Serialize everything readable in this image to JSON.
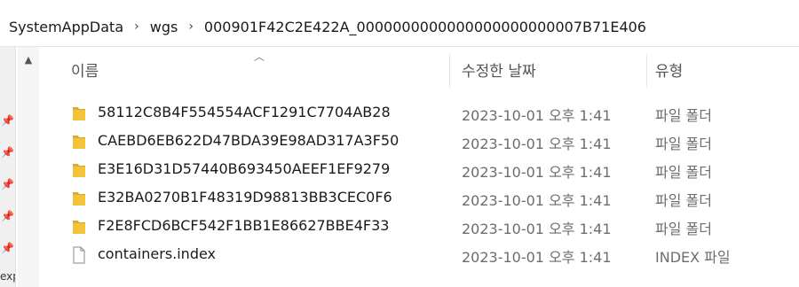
{
  "breadcrumb": {
    "items": [
      "SystemAppData",
      "wgs",
      "000901F42C2E422A_0000000000000000000000007B71E406"
    ],
    "separator": "›"
  },
  "columns": {
    "name": "이름",
    "date": "수정한 날짜",
    "type": "유형"
  },
  "files": [
    {
      "name": "58112C8B4F554554ACF1291C7704AB28",
      "date": "2023-10-01 오후 1:41",
      "type": "파일 폴더",
      "icon": "folder-icon"
    },
    {
      "name": "CAEBD6EB622D47BDA39E98AD317A3F50",
      "date": "2023-10-01 오후 1:41",
      "type": "파일 폴더",
      "icon": "folder-icon"
    },
    {
      "name": "E3E16D31D57440B693450AEEF1EF9279",
      "date": "2023-10-01 오후 1:41",
      "type": "파일 폴더",
      "icon": "folder-icon"
    },
    {
      "name": "E32BA0270B1F48319D98813BB3CEC0F6",
      "date": "2023-10-01 오후 1:41",
      "type": "파일 폴더",
      "icon": "folder-icon"
    },
    {
      "name": "F2E8FCD6BCF542F1BB1E86627BBE4F33",
      "date": "2023-10-01 오후 1:41",
      "type": "파일 폴더",
      "icon": "folder-icon"
    },
    {
      "name": "containers.index",
      "date": "2023-10-01 오후 1:41",
      "type": "INDEX 파일",
      "icon": "file-icon"
    }
  ],
  "navpane": {
    "partial_label": "exp"
  },
  "colors": {
    "folder": "#f5c33b",
    "folder_dark": "#e0a82e",
    "text_secondary": "#6d6d6d"
  }
}
